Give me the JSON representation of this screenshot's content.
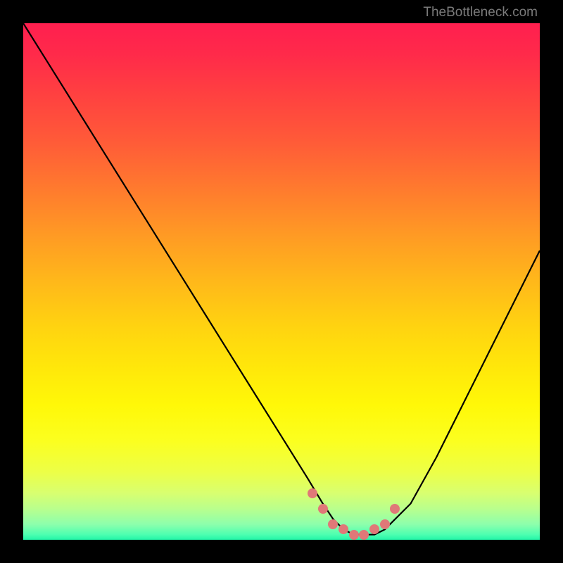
{
  "attribution": "TheBottleneck.com",
  "chart_data": {
    "type": "line",
    "title": "",
    "xlabel": "",
    "ylabel": "",
    "xlim": [
      0,
      100
    ],
    "ylim": [
      0,
      100
    ],
    "series": [
      {
        "name": "bottleneck-curve",
        "x": [
          0,
          5,
          10,
          15,
          20,
          25,
          30,
          35,
          40,
          45,
          50,
          55,
          58,
          60,
          62,
          64,
          66,
          68,
          70,
          75,
          80,
          85,
          90,
          95,
          100
        ],
        "y": [
          100,
          92,
          84,
          76,
          68,
          60,
          52,
          44,
          36,
          28,
          20,
          12,
          7,
          4,
          2,
          1,
          1,
          1,
          2,
          7,
          16,
          26,
          36,
          46,
          56
        ]
      }
    ],
    "markers": {
      "name": "highlighted-segment",
      "x": [
        56,
        58,
        60,
        62,
        64,
        66,
        68,
        70,
        72
      ],
      "y": [
        9,
        6,
        3,
        2,
        1,
        1,
        2,
        3,
        6
      ]
    },
    "background": "heat-gradient-red-to-green"
  }
}
